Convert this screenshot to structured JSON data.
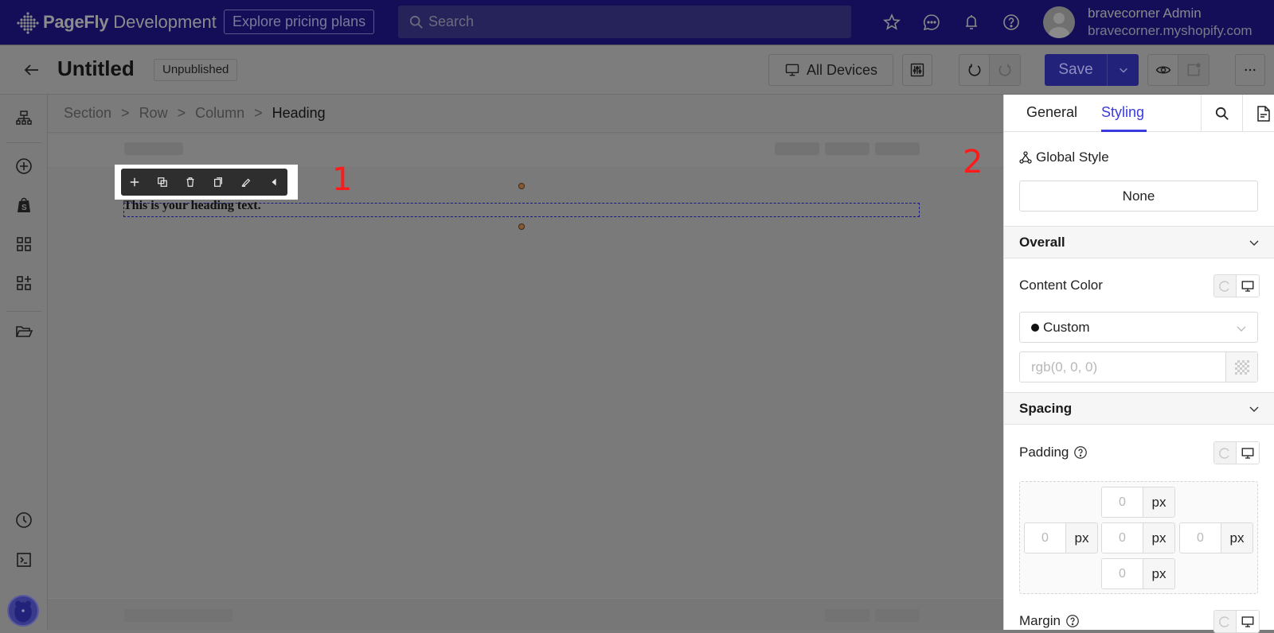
{
  "topbar": {
    "brand": "PageFly",
    "environment": "Development",
    "explore_label": "Explore pricing plans",
    "search_placeholder": "Search",
    "icons": [
      "star-icon",
      "chat-icon",
      "bell-icon",
      "help-icon"
    ],
    "user_name": "bravecorner Admin",
    "user_store": "bravecorner.myshopify.com"
  },
  "header": {
    "page_title": "Untitled",
    "status": "Unpublished",
    "device_label": "All Devices",
    "save_label": "Save"
  },
  "sidebar": {
    "items": [
      {
        "icon": "layers-tree-icon"
      },
      {
        "icon": "add-element-icon"
      },
      {
        "icon": "shopify-icon"
      },
      {
        "icon": "templates-grid-icon"
      },
      {
        "icon": "add-section-icon"
      },
      {
        "icon": "folder-icon"
      },
      {
        "icon": "history-clock-icon"
      },
      {
        "icon": "terminal-icon"
      }
    ]
  },
  "canvas": {
    "breadcrumb": [
      "Section",
      "Row",
      "Column"
    ],
    "breadcrumb_current": "Heading",
    "heading_text": "This is your heading text.",
    "annotation_1": "1",
    "annotation_2": "2",
    "toolbar_actions": [
      "move",
      "duplicate",
      "delete",
      "copy",
      "style",
      "collapse"
    ]
  },
  "panel": {
    "tabs": [
      {
        "label": "General",
        "active": false
      },
      {
        "label": "Styling",
        "active": true
      }
    ],
    "global_style_label": "Global Style",
    "global_style_value": "None",
    "overall_label": "Overall",
    "content_color_label": "Content Color",
    "content_color_mode": "Custom",
    "content_color_placeholder": "rgb(0, 0, 0)",
    "spacing_label": "Spacing",
    "padding_label": "Padding",
    "padding": {
      "top": {
        "placeholder": "0",
        "unit": "px"
      },
      "left": {
        "placeholder": "0",
        "unit": "px"
      },
      "center": {
        "placeholder": "0",
        "unit": "px"
      },
      "right": {
        "placeholder": "0",
        "unit": "px"
      },
      "bottom": {
        "placeholder": "0",
        "unit": "px"
      }
    },
    "margin_label": "Margin"
  },
  "colors": {
    "brand_navy": "#1a1378",
    "accent_blue": "#3a3ae0",
    "save_blue": "#2a2aa0",
    "annotation_red": "#ff1a1a"
  }
}
